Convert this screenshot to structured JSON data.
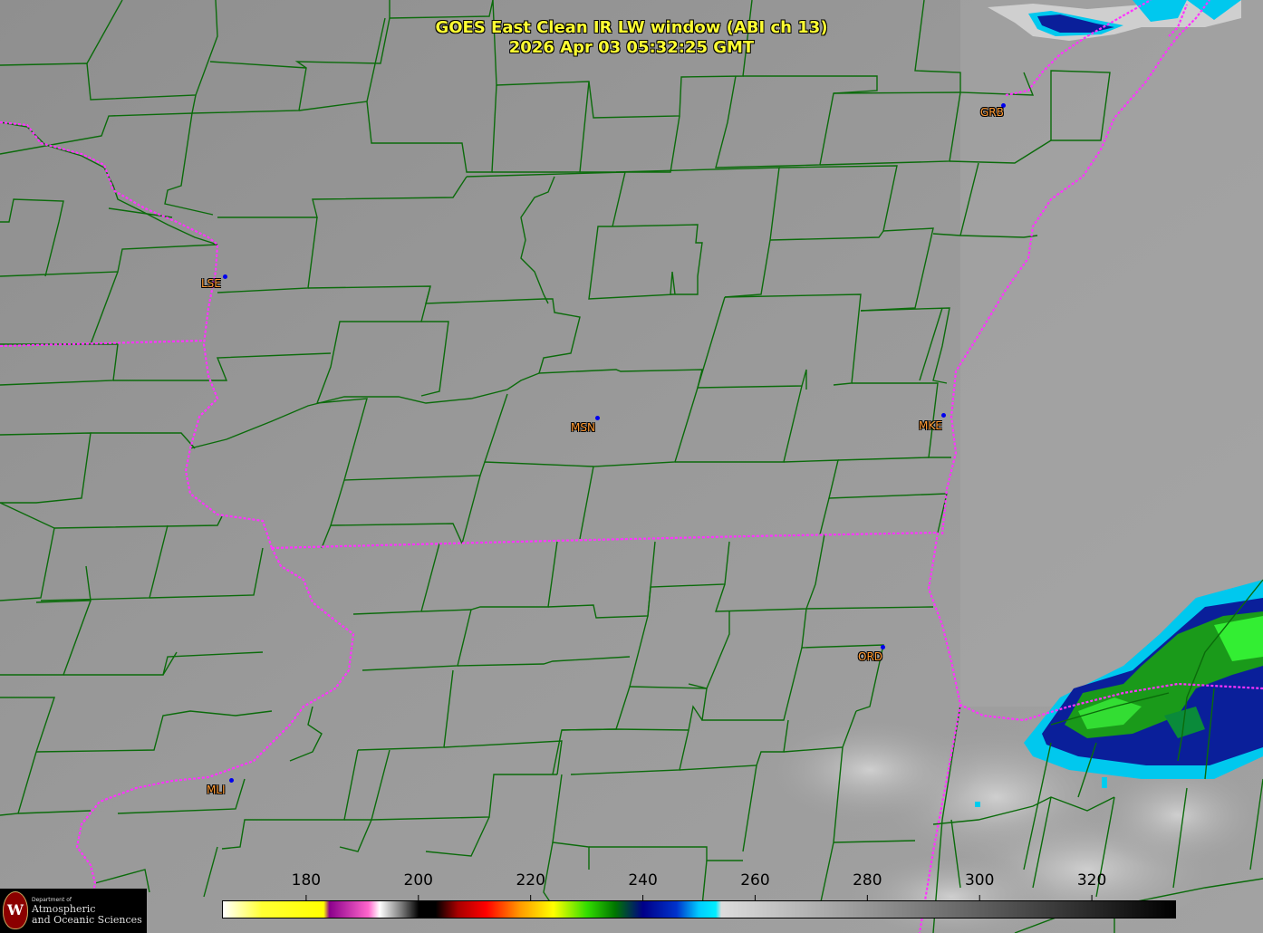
{
  "title": {
    "line1": "GOES East Clean IR LW window (ABI ch 13)",
    "line2": "2026 Apr 03  05:32:25 GMT"
  },
  "stations": [
    {
      "id": "GRB"
    },
    {
      "id": "LSE"
    },
    {
      "id": "MSN"
    },
    {
      "id": "MKE"
    },
    {
      "id": "ORD"
    },
    {
      "id": "MLI"
    }
  ],
  "colorbar": {
    "unit_range": [
      165,
      335
    ],
    "ticks": [
      "180",
      "200",
      "220",
      "240",
      "260",
      "280",
      "300",
      "320"
    ],
    "tick_values": [
      180,
      200,
      220,
      240,
      260,
      280,
      300,
      320
    ],
    "stops": [
      {
        "value": 165,
        "color": "#ffffff"
      },
      {
        "value": 172,
        "color": "#ffff33"
      },
      {
        "value": 183,
        "color": "#ffff00"
      },
      {
        "value": 184,
        "color": "#8b008b"
      },
      {
        "value": 191,
        "color": "#ff66cc"
      },
      {
        "value": 193,
        "color": "#ffffff"
      },
      {
        "value": 197,
        "color": "#777777"
      },
      {
        "value": 200,
        "color": "#000000"
      },
      {
        "value": 203,
        "color": "#000000"
      },
      {
        "value": 207,
        "color": "#aa0000"
      },
      {
        "value": 212,
        "color": "#ff0000"
      },
      {
        "value": 218,
        "color": "#ff9900"
      },
      {
        "value": 224,
        "color": "#ffff00"
      },
      {
        "value": 230,
        "color": "#33dd00"
      },
      {
        "value": 235,
        "color": "#007700"
      },
      {
        "value": 240,
        "color": "#000088"
      },
      {
        "value": 246,
        "color": "#0033cc"
      },
      {
        "value": 250,
        "color": "#00ccff"
      },
      {
        "value": 253,
        "color": "#00eeff"
      },
      {
        "value": 254,
        "color": "#dddddd"
      },
      {
        "value": 335,
        "color": "#000000"
      }
    ]
  },
  "logo": {
    "dept": "Department of",
    "line1": "Atmospheric",
    "line2": "and Oceanic Sciences",
    "seal": "W"
  },
  "colors": {
    "county_lines": "#0b6b0b",
    "state_lines": "#ff33ff",
    "station_label": "#ff9933",
    "station_dot": "#0000ee",
    "title": "#ffff33"
  }
}
